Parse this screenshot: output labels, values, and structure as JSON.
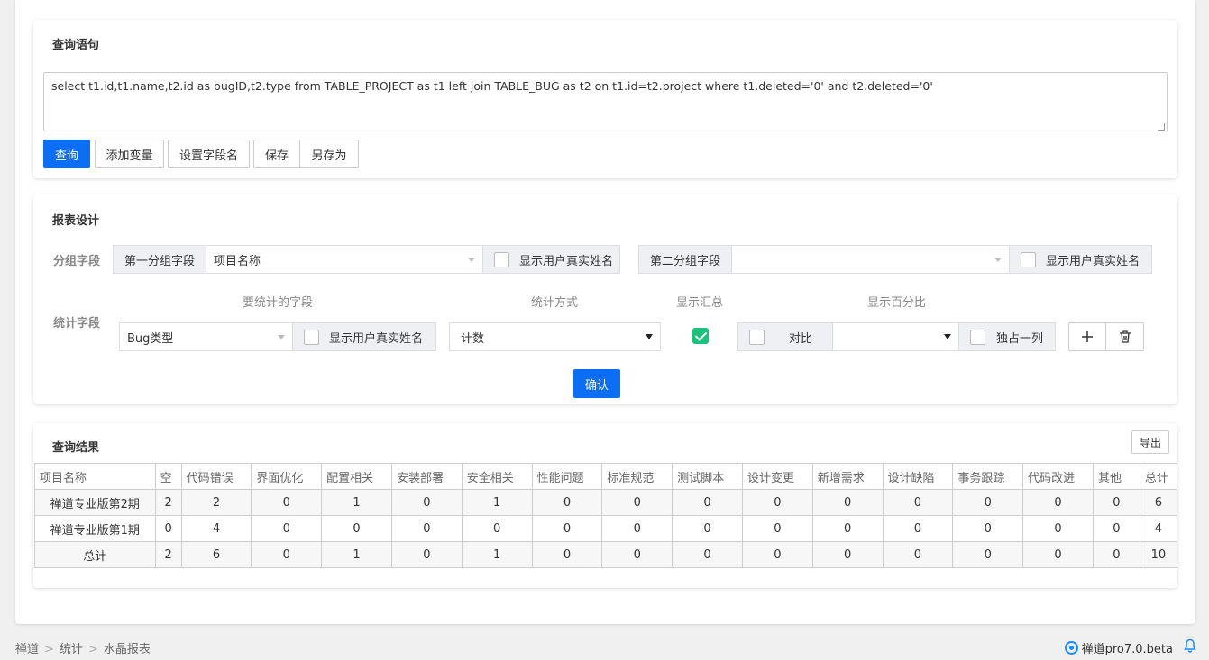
{
  "query_panel": {
    "title": "查询语句",
    "sql": "select t1.id,t1.name,t2.id as bugID,t2.type from TABLE_PROJECT as t1 left join TABLE_BUG as t2 on t1.id=t2.project where t1.deleted='0' and t2.deleted='0'",
    "buttons": {
      "query": "查询",
      "add_variable": "添加变量",
      "set_field_name": "设置字段名",
      "save": "保存",
      "save_as": "另存为"
    }
  },
  "design_panel": {
    "title": "报表设计",
    "group_label": "分组字段",
    "group1_addon": "第一分组字段",
    "group1_value": "项目名称",
    "group2_addon": "第二分组字段",
    "group2_value": "",
    "show_real_name": "显示用户真实姓名",
    "stat_label": "统计字段",
    "col_field": "要统计的字段",
    "col_method": "统计方式",
    "col_summary": "显示汇总",
    "col_percent": "显示百分比",
    "stat_field_value": "Bug类型",
    "stat_method_value": "计数",
    "summary_checked": true,
    "compare_label": "对比",
    "compare_value": "",
    "own_column_label": "独占一列",
    "add_icon": "plus-icon",
    "delete_icon": "trash-icon",
    "confirm": "确认"
  },
  "result_panel": {
    "title": "查询结果",
    "export": "导出",
    "headers": [
      "项目名称",
      "空",
      "代码错误",
      "界面优化",
      "配置相关",
      "安装部署",
      "安全相关",
      "性能问题",
      "标准规范",
      "测试脚本",
      "设计变更",
      "新增需求",
      "设计缺陷",
      "事务跟踪",
      "代码改进",
      "其他",
      "总计"
    ],
    "rows": [
      [
        "禅道专业版第2期",
        "2",
        "2",
        "0",
        "1",
        "0",
        "1",
        "0",
        "0",
        "0",
        "0",
        "0",
        "0",
        "0",
        "0",
        "0",
        "6"
      ],
      [
        "禅道专业版第1期",
        "0",
        "4",
        "0",
        "0",
        "0",
        "0",
        "0",
        "0",
        "0",
        "0",
        "0",
        "0",
        "0",
        "0",
        "0",
        "4"
      ],
      [
        "总计",
        "2",
        "6",
        "0",
        "1",
        "0",
        "1",
        "0",
        "0",
        "0",
        "0",
        "0",
        "0",
        "0",
        "0",
        "0",
        "10"
      ]
    ]
  },
  "footer": {
    "breadcrumb": [
      "禅道",
      "统计",
      "水晶报表"
    ],
    "version": "禅道pro7.0.beta",
    "logo_icon": "zentao-logo-icon",
    "bell_icon": "bell-icon"
  },
  "colors": {
    "primary": "#0c6ef5",
    "check_green": "#18c27a",
    "logo_blue": "#1a8cff"
  }
}
